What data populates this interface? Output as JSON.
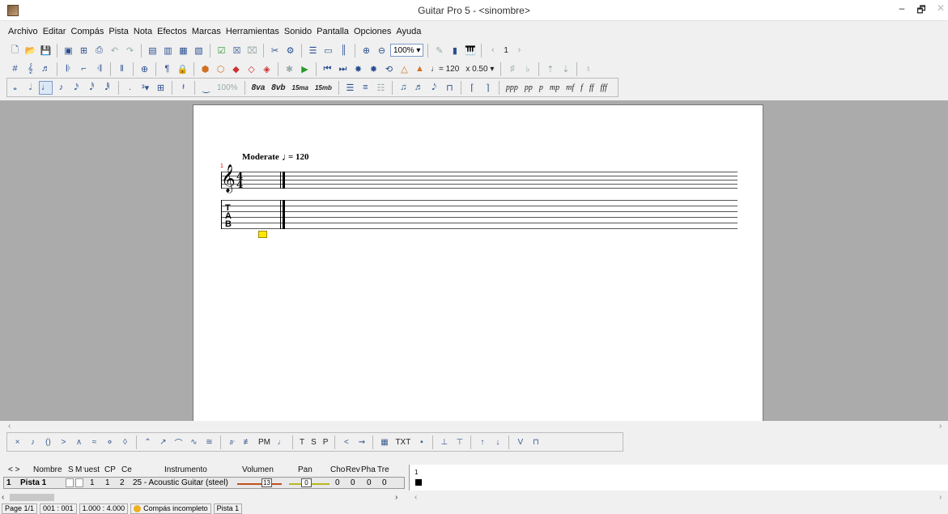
{
  "window": {
    "title": "Guitar Pro 5 - <sinombre>",
    "minimize": "–",
    "maximize": "🗗",
    "close": "✕"
  },
  "menu": [
    "Archivo",
    "Editar",
    "Compás",
    "Pista",
    "Nota",
    "Efectos",
    "Marcas",
    "Herramientas",
    "Sonido",
    "Pantalla",
    "Opciones",
    "Ayuda"
  ],
  "toolbar1": {
    "zoom_value": "100%",
    "page_number": "1"
  },
  "toolbar2": {
    "tempo": "♩= 120",
    "speed": "x 0.50"
  },
  "toolbar3": {
    "zoom_disabled": "100%",
    "ottava": [
      "8va",
      "8vb",
      "15ma",
      "15mb"
    ],
    "dynamics": [
      "ppp",
      "pp",
      "p",
      "mp",
      "mf",
      "f",
      "ff",
      "fff"
    ]
  },
  "score": {
    "tempo_label": "Moderate",
    "tempo_note": "♩",
    "tempo_value": "= 120",
    "bar_number": "1",
    "time_sig_top": "4",
    "time_sig_bottom": "4",
    "tab_letters": [
      "T",
      "A",
      "B"
    ]
  },
  "effects_bar": {
    "pm_label": "PM",
    "tsp": [
      "T",
      "S",
      "P"
    ],
    "txt_label": "TXT"
  },
  "track_table": {
    "headers": {
      "nav": "< >",
      "name": "Nombre",
      "s": "S",
      "m": "M",
      "puest": "Puest",
      "cp": "CP",
      "ce": "Ce",
      "instrument": "Instrumento",
      "volume": "Volumen",
      "pan": "Pan",
      "cho": "Cho",
      "rev": "Rev",
      "pha": "Pha",
      "tre": "Tre"
    },
    "row": {
      "index": "1",
      "name": "Pista 1",
      "puest": "1",
      "cp": "1",
      "ce": "2",
      "instrument": "25 - Acoustic Guitar (steel)",
      "volume": "13",
      "pan": "0",
      "cho": "0",
      "rev": "0",
      "pha": "0",
      "tre": "0"
    },
    "timeline_bar": "1"
  },
  "status": {
    "page": "Page 1/1",
    "bar": "001 : 001",
    "time": "1.000 : 4.000",
    "warning": "Compás incompleto",
    "track": "Pista 1"
  }
}
